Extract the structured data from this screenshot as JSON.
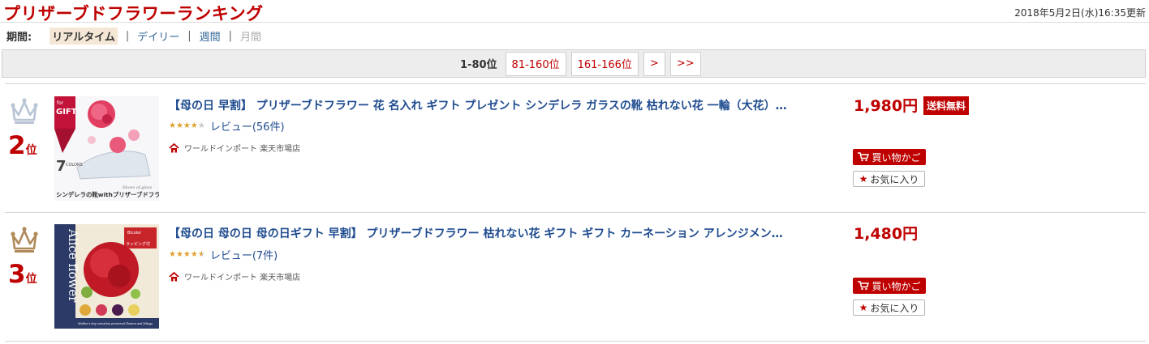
{
  "header": {
    "title": "プリザーブドフラワーランキング",
    "updated": "2018年5月2日(水)16:35更新"
  },
  "period": {
    "label": "期間:",
    "tabs": [
      {
        "label": "リアルタイム",
        "state": "active"
      },
      {
        "label": "デイリー",
        "state": "link"
      },
      {
        "label": "週間",
        "state": "link"
      },
      {
        "label": "月間",
        "state": "disabled"
      }
    ],
    "separator": "|"
  },
  "pager": {
    "current": "1-80位",
    "links": [
      "81-160位",
      "161-166位",
      ">",
      ">>"
    ]
  },
  "items": [
    {
      "rank_num": "2",
      "rank_unit": "位",
      "crown_color": "#b9c4d4",
      "title": "【母の日 早割】 プリザーブドフラワー 花 名入れ ギフト プレゼント シンデレラ ガラスの靴 枯れない花 一輪（大花）…",
      "stars": "★★★★",
      "stars_off": "★",
      "rating": 4,
      "review": "レビュー(56件)",
      "shop": "ワールドインポート 楽天市場店",
      "price": "1,980円",
      "badge": "送料無料",
      "cart": "買い物かご",
      "fav": "お気に入り",
      "image_text": {
        "gift_for": "for",
        "gift": "GIFT",
        "colors_num": "7",
        "colors_word": "COLORS",
        "caption": "シンデレラの靴withプリザーブドフラワー",
        "script": "Shoes of glass"
      }
    },
    {
      "rank_num": "3",
      "rank_unit": "位",
      "crown_color": "#b08a5a",
      "title": "【母の日 母の日 母の日ギフト 早割】 プリザーブドフラワー 枯れない花 ギフト ギフト カーネーション アレンジメン…",
      "stars": "★★★★",
      "stars_off": "",
      "rating": 4.5,
      "review": "レビュー(7件)",
      "shop": "ワールドインポート 楽天市場店",
      "price": "1,480円",
      "badge": "",
      "cart": "買い物かご",
      "fav": "お気に入り",
      "image_text": {
        "brand": "Alice flower",
        "tag1": "Bicolor",
        "tag2": "ラッピング付",
        "bottom": "Mother's day carnation preserved flowers and foliage"
      }
    }
  ],
  "colors": {
    "accent": "#bf0000",
    "link": "#1e4b8f",
    "pager_bg": "#ededed",
    "star": "#e0a030"
  }
}
